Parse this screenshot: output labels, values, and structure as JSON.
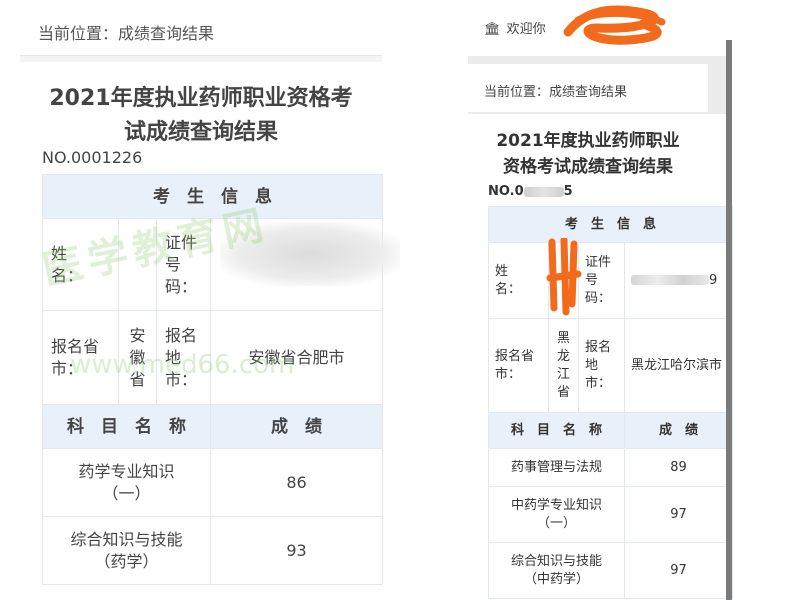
{
  "left": {
    "breadcrumb": "当前位置：成绩查询结果",
    "title_line1": "2021年度执业药师职业资格考",
    "title_line2": "试成绩查询结果",
    "serial": "NO.0001226",
    "section_header": "考　生　信　息",
    "name_label_1": "姓",
    "name_label_2": "名：",
    "id_label_1": "证件",
    "id_label_2": "号",
    "id_label_3": "码：",
    "province_label_1": "报名省",
    "province_label_2": "市：",
    "province_value_1": "安",
    "province_value_2": "徽",
    "province_value_3": "省",
    "city_label_1": "报名",
    "city_label_2": "地",
    "city_label_3": "市：",
    "city_value": "安徽省合肥市",
    "subject_header": "科　目　名　称",
    "score_header": "成　绩",
    "rows": [
      {
        "subject_1": "药学专业知识",
        "subject_2": "（一）",
        "score": "86"
      },
      {
        "subject_1": "综合知识与技能",
        "subject_2": "（药学）",
        "score": "93"
      }
    ],
    "watermark_text": "医学教育网",
    "watermark_url": "www.med66.com"
  },
  "right": {
    "welcome": "欢迎你",
    "welcome_icon": "bank-icon",
    "breadcrumb": "当前位置：成绩查询结果",
    "title_line1": "2021年度执业药师职业",
    "title_line2": "资格考试成绩查询结果",
    "serial_prefix": "NO.0",
    "serial_suffix": "5",
    "section_header": "考　生　信　息",
    "name_label_1": "姓",
    "name_label_2": "名：",
    "id_label_1": "证件",
    "id_label_2": "号",
    "id_label_3": "码：",
    "id_suffix": "9",
    "province_label_1": "报名省",
    "province_label_2": "市：",
    "province_value_1": "黑",
    "province_value_2": "龙",
    "province_value_3": "江",
    "province_value_4": "省",
    "city_label_1": "报名",
    "city_label_2": "地",
    "city_label_3": "市：",
    "city_value": "黑龙江哈尔滨市",
    "subject_header": "科　目　名　称",
    "score_header": "成　绩",
    "rows": [
      {
        "subject_1": "药事管理与法规",
        "subject_2": "",
        "score": "89"
      },
      {
        "subject_1": "中药学专业知识",
        "subject_2": "（一）",
        "score": "97"
      },
      {
        "subject_1": "综合知识与技能",
        "subject_2": "（中药学）",
        "score": "97"
      }
    ]
  },
  "colors": {
    "header_bg": "#e8f0f9",
    "border": "#e2e8ee",
    "watermark": "#8cc86e",
    "redaction_orange": "#f26a1b"
  }
}
